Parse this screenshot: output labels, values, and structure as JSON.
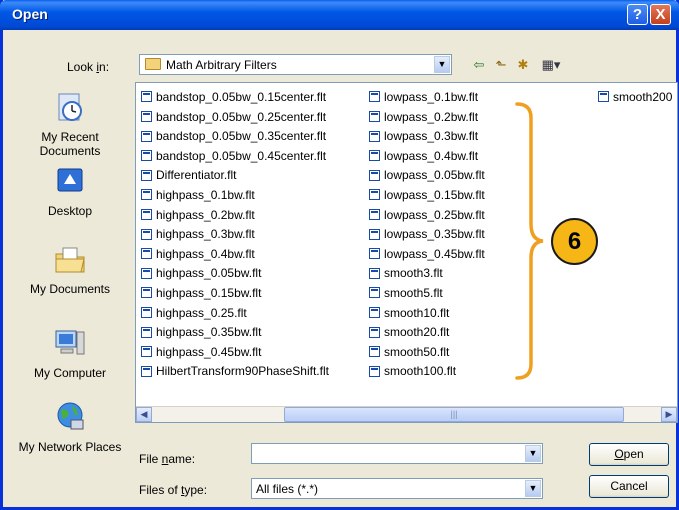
{
  "window": {
    "title": "Open",
    "help_glyph": "?",
    "close_glyph": "X"
  },
  "lookin": {
    "label": "Look in:",
    "value": "Math Arbitrary Filters",
    "arrow": "▼"
  },
  "toolbar": {
    "back": "⇦",
    "up": "⬑",
    "newfolder": "✱",
    "views": "▦▾"
  },
  "places": [
    {
      "label": "My Recent Documents",
      "icon": "recent-documents-icon"
    },
    {
      "label": "Desktop",
      "icon": "desktop-icon"
    },
    {
      "label": "My Documents",
      "icon": "my-documents-icon"
    },
    {
      "label": "My Computer",
      "icon": "my-computer-icon"
    },
    {
      "label": "My Network Places",
      "icon": "network-places-icon"
    }
  ],
  "files": {
    "col1": [
      "bandstop_0.05bw_0.15center.flt",
      "bandstop_0.05bw_0.25center.flt",
      "bandstop_0.05bw_0.35center.flt",
      "bandstop_0.05bw_0.45center.flt",
      "Differentiator.flt",
      "highpass_0.1bw.flt",
      "highpass_0.2bw.flt",
      "highpass_0.3bw.flt",
      "highpass_0.4bw.flt",
      "highpass_0.05bw.flt",
      "highpass_0.15bw.flt",
      "highpass_0.25.flt",
      "highpass_0.35bw.flt",
      "highpass_0.45bw.flt",
      "HilbertTransform90PhaseShift.flt"
    ],
    "col2": [
      "lowpass_0.1bw.flt",
      "lowpass_0.2bw.flt",
      "lowpass_0.3bw.flt",
      "lowpass_0.4bw.flt",
      "lowpass_0.05bw.flt",
      "lowpass_0.15bw.flt",
      "lowpass_0.25bw.flt",
      "lowpass_0.35bw.flt",
      "lowpass_0.45bw.flt",
      "smooth3.flt",
      "smooth5.flt",
      "smooth10.flt",
      "smooth20.flt",
      "smooth50.flt",
      "smooth100.flt"
    ],
    "col3": [
      "smooth200"
    ]
  },
  "scroll": {
    "left": "◀",
    "right": "▶",
    "grip": "|||"
  },
  "filename": {
    "label_pre": "File ",
    "label_key": "n",
    "label_post": "ame:",
    "value": ""
  },
  "filetype": {
    "label_pre": "Files of ",
    "label_key": "t",
    "label_post": "ype:",
    "value": "All files (*.*)"
  },
  "buttons": {
    "open_key": "O",
    "open_rest": "pen",
    "cancel": "Cancel"
  },
  "callout": {
    "number": "6",
    "color": "#f5b616",
    "brace_color": "#f0a020"
  }
}
